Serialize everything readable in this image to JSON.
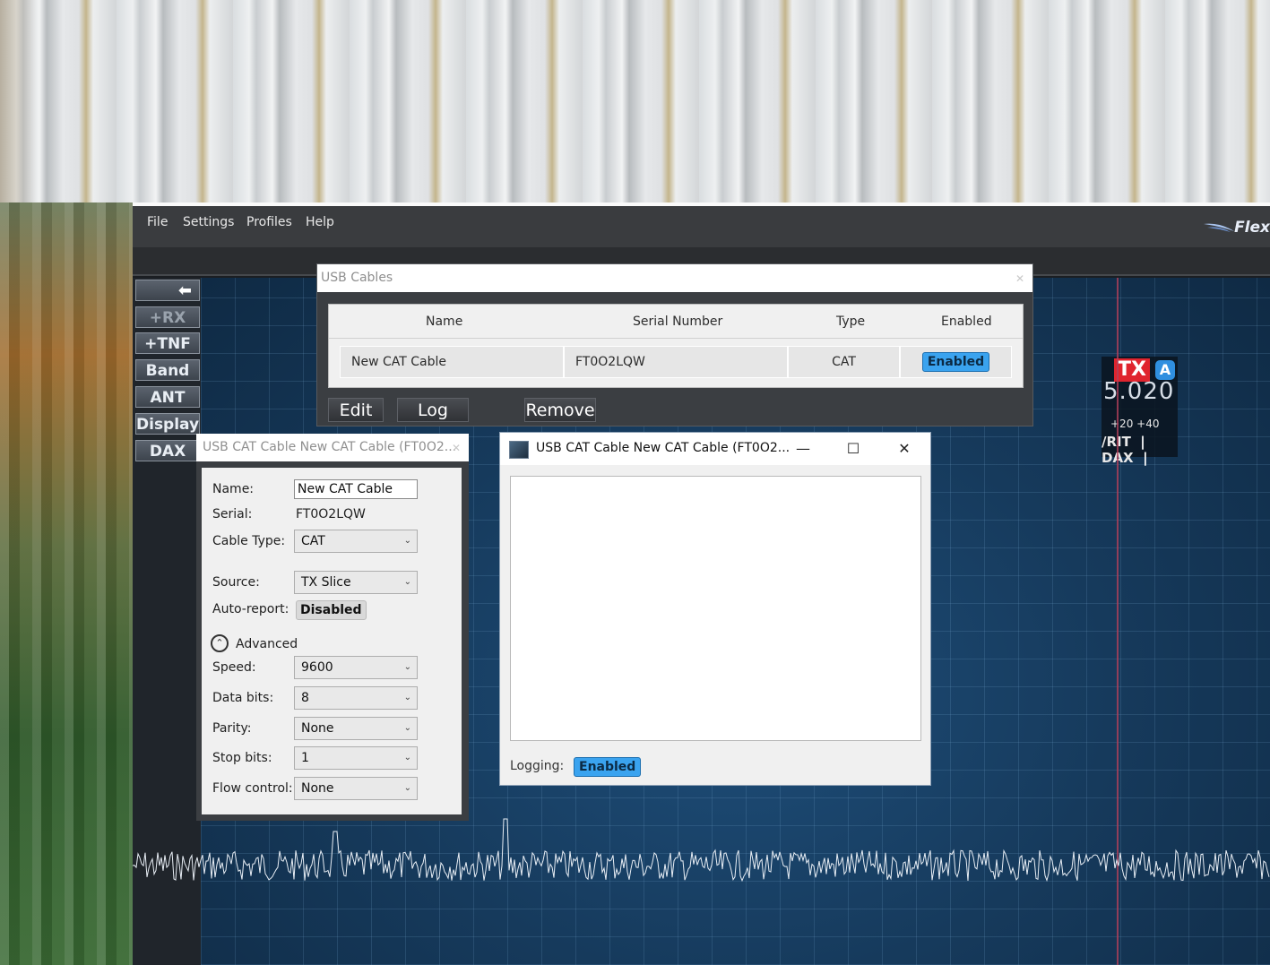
{
  "main_window": {
    "menu": [
      "File",
      "Settings",
      "Profiles",
      "Help"
    ],
    "brand": "Flex",
    "side_buttons": [
      "+RX",
      "+TNF",
      "Band",
      "ANT",
      "Display",
      "DAX"
    ],
    "back_arrow": "back-arrow-icon",
    "slice": {
      "tx_label": "TX",
      "slice_letter": "A",
      "frequency": "5.020",
      "offsets": "+20  +40",
      "rit_label": "/RIT",
      "dax_label": "DAX"
    }
  },
  "usb_cables_window": {
    "title": "USB Cables",
    "close_icon": "close-icon",
    "columns": [
      "Name",
      "Serial Number",
      "Type",
      "Enabled"
    ],
    "rows": [
      {
        "name": "New CAT Cable",
        "serial": "FT0O2LQW",
        "type": "CAT",
        "enabled": "Enabled"
      }
    ],
    "buttons": {
      "edit": "Edit",
      "log": "Log",
      "remove": "Remove"
    }
  },
  "cable_editor_window": {
    "title": "USB CAT Cable New CAT Cable (FT0O2...",
    "close_icon": "close-icon",
    "fields": {
      "name_label": "Name:",
      "name_value": "New CAT Cable",
      "serial_label": "Serial:",
      "serial_value": "FT0O2LQW",
      "cable_type_label": "Cable Type:",
      "cable_type_value": "CAT",
      "source_label": "Source:",
      "source_value": "TX Slice",
      "auto_report_label": "Auto-report:",
      "auto_report_value": "Disabled",
      "advanced_label": "Advanced",
      "speed_label": "Speed:",
      "speed_value": "9600",
      "data_bits_label": "Data bits:",
      "data_bits_value": "8",
      "parity_label": "Parity:",
      "parity_value": "None",
      "stop_bits_label": "Stop bits:",
      "stop_bits_value": "1",
      "flow_control_label": "Flow control:",
      "flow_control_value": "None"
    }
  },
  "log_window": {
    "title": "USB CAT Cable New CAT Cable (FT0O2...",
    "app_icon": "app-icon",
    "controls": {
      "minimize": "—",
      "maximize": "☐",
      "close": "✕"
    },
    "logging_label": "Logging:",
    "logging_value": "Enabled"
  },
  "colors": {
    "accent_blue": "#3aa3ef",
    "tx_red": "#e0242e",
    "panadapter_bg": "#163a5c",
    "window_dark": "#3b3e42"
  }
}
